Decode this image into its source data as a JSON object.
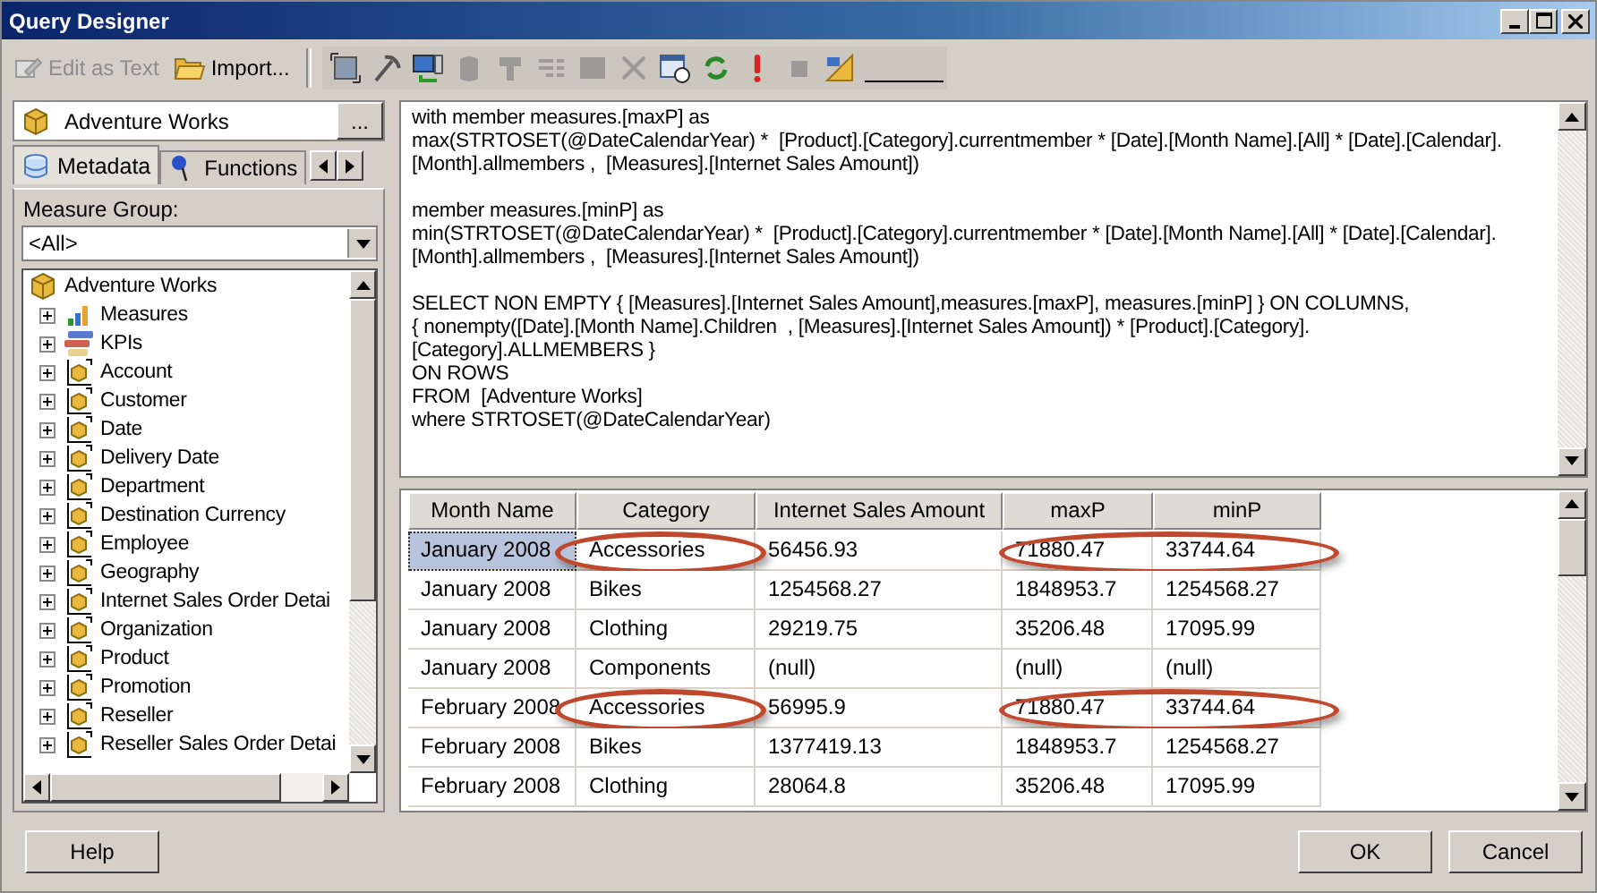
{
  "window": {
    "title": "Query Designer"
  },
  "toolbar": {
    "text_buttons": [
      {
        "label": "Edit as Text",
        "kind": "edit",
        "disabled": true
      },
      {
        "label": "Import...",
        "kind": "folder",
        "disabled": false
      }
    ],
    "tools": [
      {
        "kind": "fit",
        "disabled": false
      },
      {
        "kind": "pick",
        "disabled": false
      },
      {
        "kind": "connect",
        "disabled": false
      },
      {
        "kind": "cylinder",
        "disabled": true
      },
      {
        "kind": "funnel",
        "disabled": true
      },
      {
        "kind": "list",
        "disabled": true
      },
      {
        "kind": "square",
        "disabled": true
      },
      {
        "kind": "delete",
        "disabled": true
      },
      {
        "kind": "param",
        "disabled": false
      },
      {
        "kind": "refresh",
        "disabled": false
      },
      {
        "kind": "run",
        "disabled": false
      },
      {
        "kind": "stop",
        "disabled": true
      },
      {
        "kind": "layout",
        "disabled": false
      }
    ]
  },
  "cube_selector": {
    "value": "Adventure Works",
    "button": "..."
  },
  "tabs": [
    {
      "label": "Metadata",
      "kind": "metadata",
      "selected": true
    },
    {
      "label": "Functions",
      "kind": "functions",
      "selected": false
    }
  ],
  "measure_group": {
    "label": "Measure Group:",
    "value": "<All>"
  },
  "tree": {
    "label": "Adventure Works",
    "kind": "cube",
    "children": [
      {
        "label": "Measures",
        "kind": "measures",
        "expanded": false
      },
      {
        "label": "KPIs",
        "kind": "kpis",
        "expanded": false
      },
      {
        "label": "Account",
        "kind": "dimension",
        "expanded": false
      },
      {
        "label": "Customer",
        "kind": "dimension",
        "expanded": false
      },
      {
        "label": "Date",
        "kind": "dimension",
        "expanded": false
      },
      {
        "label": "Delivery Date",
        "kind": "dimension",
        "expanded": false
      },
      {
        "label": "Department",
        "kind": "dimension",
        "expanded": false
      },
      {
        "label": "Destination Currency",
        "kind": "dimension",
        "expanded": false
      },
      {
        "label": "Employee",
        "kind": "dimension",
        "expanded": false
      },
      {
        "label": "Geography",
        "kind": "dimension",
        "expanded": false
      },
      {
        "label": "Internet Sales Order Detai",
        "kind": "dimension",
        "expanded": false
      },
      {
        "label": "Organization",
        "kind": "dimension",
        "expanded": false
      },
      {
        "label": "Product",
        "kind": "dimension",
        "expanded": false
      },
      {
        "label": "Promotion",
        "kind": "dimension",
        "expanded": false
      },
      {
        "label": "Reseller",
        "kind": "dimension",
        "expanded": false
      },
      {
        "label": "Reseller Sales Order Detai",
        "kind": "dimension",
        "expanded": false
      }
    ]
  },
  "query": [
    [
      "with member measures.[maxP] as",
      "max(STRTOSET(@DateCalendarYear) *  [Product].[Category].currentmember * [Date].[Month Name].[All] * [Date].[Calendar].",
      "[Month].allmembers ,  [Measures].[Internet Sales Amount])"
    ],
    [
      "member measures.[minP] as",
      "min(STRTOSET(@DateCalendarYear) *  [Product].[Category].currentmember * [Date].[Month Name].[All] * [Date].[Calendar].",
      "[Month].allmembers ,  [Measures].[Internet Sales Amount])"
    ],
    [
      "SELECT NON EMPTY { [Measures].[Internet Sales Amount],measures.[maxP], measures.[minP] } ON COLUMNS,",
      "{ nonempty([Date].[Month Name].Children  , [Measures].[Internet Sales Amount]) * [Product].[Category].",
      "[Category].ALLMEMBERS }",
      "ON ROWS",
      "FROM  [Adventure Works]",
      "where STRTOSET(@DateCalendarYear)"
    ]
  ],
  "results": {
    "columns": [
      "Month Name",
      "Category",
      "Internet Sales Amount",
      "maxP",
      "minP"
    ],
    "rows": [
      {
        "cells": [
          "January 2008",
          "Accessories",
          "56456.93",
          "71880.47",
          "33744.64"
        ],
        "selected": true,
        "circled": true
      },
      {
        "cells": [
          "January 2008",
          "Bikes",
          "1254568.27",
          "1848953.7",
          "1254568.27"
        ],
        "selected": false,
        "circled": false
      },
      {
        "cells": [
          "January 2008",
          "Clothing",
          "29219.75",
          "35206.48",
          "17095.99"
        ],
        "selected": false,
        "circled": false
      },
      {
        "cells": [
          "January 2008",
          "Components",
          "(null)",
          "(null)",
          "(null)"
        ],
        "selected": false,
        "circled": false
      },
      {
        "cells": [
          "February 2008",
          "Accessories",
          "56995.9",
          "71880.47",
          "33744.64"
        ],
        "selected": false,
        "circled": true
      },
      {
        "cells": [
          "February 2008",
          "Bikes",
          "1377419.13",
          "1848953.7",
          "1254568.27"
        ],
        "selected": false,
        "circled": false
      },
      {
        "cells": [
          "February 2008",
          "Clothing",
          "28064.8",
          "35206.48",
          "17095.99"
        ],
        "selected": false,
        "circled": false
      }
    ]
  },
  "buttons": {
    "help": "Help",
    "ok": "OK",
    "cancel": "Cancel"
  }
}
